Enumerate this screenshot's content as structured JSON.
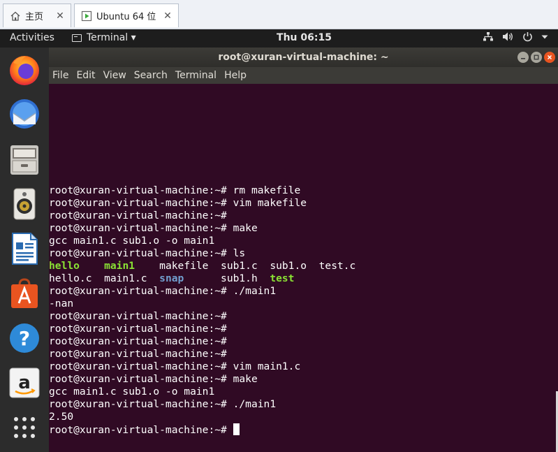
{
  "host_tabs": [
    {
      "label": "主页",
      "icon": "home-icon",
      "close": "✕"
    },
    {
      "label": "Ubuntu 64 位",
      "icon": "vm-play-icon",
      "close": "✕"
    }
  ],
  "topbar": {
    "activities": "Activities",
    "app_menu": "Terminal ▾",
    "clock": "Thu 06:15",
    "tray_icons": [
      "network-icon",
      "volume-icon",
      "power-icon",
      "chevron-down-icon"
    ]
  },
  "dock": [
    {
      "name": "firefox-icon"
    },
    {
      "name": "thunderbird-icon"
    },
    {
      "name": "files-icon"
    },
    {
      "name": "rhythmbox-icon"
    },
    {
      "name": "libreoffice-writer-icon"
    },
    {
      "name": "software-center-icon"
    },
    {
      "name": "help-icon"
    },
    {
      "name": "amazon-icon"
    },
    {
      "name": "show-apps-icon"
    }
  ],
  "window": {
    "title": "root@xuran-virtual-machine: ~",
    "menu": [
      "File",
      "Edit",
      "View",
      "Search",
      "Terminal",
      "Help"
    ]
  },
  "colors": {
    "terminal_bg": "#300a24",
    "exec_green": "#8ae234",
    "dir_blue": "#729fcf",
    "ubuntu_orange": "#e95420"
  },
  "terminal": {
    "prompt": "root@xuran-virtual-machine:~#",
    "lines": [
      {
        "type": "cmd",
        "text": " rm makefile"
      },
      {
        "type": "cmd",
        "text": " vim makefile"
      },
      {
        "type": "cmd",
        "text": ""
      },
      {
        "type": "cmd",
        "text": " make"
      },
      {
        "type": "out",
        "text": "gcc main1.c sub1.o -o main1"
      },
      {
        "type": "cmd",
        "text": " ls"
      },
      {
        "type": "ls",
        "segments": [
          {
            "text": "hello",
            "color": "green"
          },
          {
            "text": "    ",
            "color": ""
          },
          {
            "text": "main1",
            "color": "green"
          },
          {
            "text": "    makefile  sub1.c  sub1.o  test.c",
            "color": ""
          }
        ]
      },
      {
        "type": "ls",
        "segments": [
          {
            "text": "hello.c  main1.c  ",
            "color": ""
          },
          {
            "text": "snap",
            "color": "blue"
          },
          {
            "text": "      sub1.h  ",
            "color": ""
          },
          {
            "text": "test",
            "color": "green"
          }
        ]
      },
      {
        "type": "cmd",
        "text": " ./main1"
      },
      {
        "type": "out",
        "text": "-nan"
      },
      {
        "type": "cmd",
        "text": ""
      },
      {
        "type": "cmd",
        "text": ""
      },
      {
        "type": "cmd",
        "text": ""
      },
      {
        "type": "cmd",
        "text": ""
      },
      {
        "type": "cmd",
        "text": " vim main1.c"
      },
      {
        "type": "cmd",
        "text": " make"
      },
      {
        "type": "out",
        "text": "gcc main1.c sub1.o -o main1"
      },
      {
        "type": "cmd",
        "text": " ./main1"
      },
      {
        "type": "out",
        "text": "2.50"
      },
      {
        "type": "cursor",
        "text": " "
      }
    ]
  }
}
